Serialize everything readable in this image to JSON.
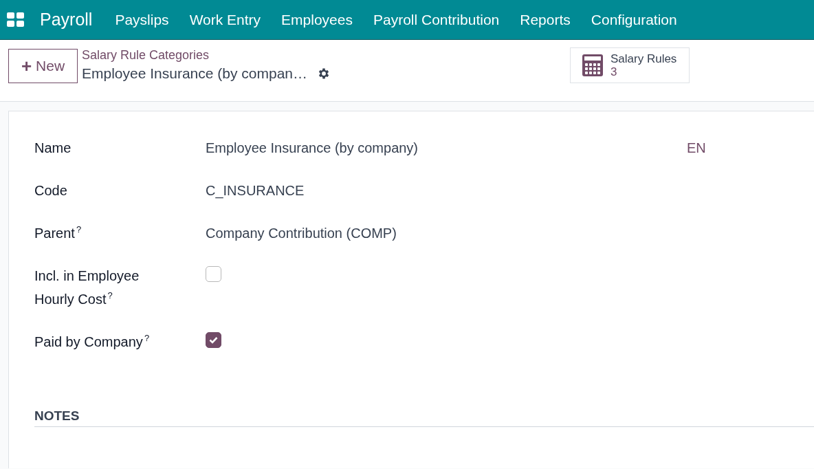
{
  "navbar": {
    "app_name": "Payroll",
    "menu": [
      "Payslips",
      "Work Entry",
      "Employees",
      "Payroll Contribution",
      "Reports",
      "Configuration"
    ]
  },
  "control_panel": {
    "new_button": {
      "icon": "+",
      "label": "New"
    },
    "breadcrumb": "Salary Rule Categories",
    "record_title": "Employee Insurance (by compan…",
    "smart_button": {
      "label": "Salary Rules",
      "count": "3"
    }
  },
  "form": {
    "fields": [
      {
        "kind": "text",
        "label": "Name",
        "value": "Employee Insurance (by company)",
        "language": "EN"
      },
      {
        "kind": "text",
        "label": "Code",
        "value": "C_INSURANCE"
      },
      {
        "kind": "text",
        "label": "Parent",
        "help": "?",
        "value": "Company Contribution (COMP)"
      },
      {
        "kind": "checkbox",
        "label": "Incl. in Employee Hourly Cost",
        "help": "?",
        "checked": false
      },
      {
        "kind": "checkbox",
        "label": "Paid by Company",
        "help": "?",
        "checked": true
      }
    ],
    "notes_heading": "NOTES"
  }
}
